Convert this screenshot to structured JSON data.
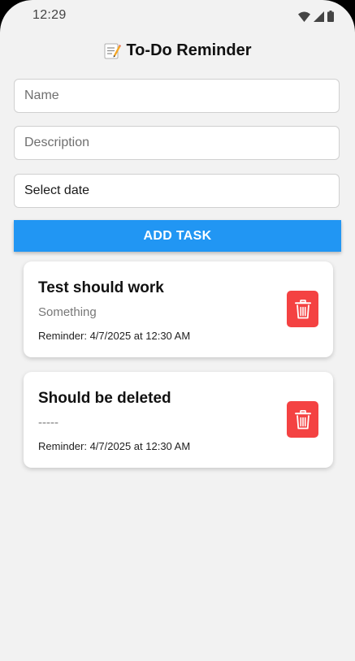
{
  "status_bar": {
    "time": "12:29",
    "icons": [
      "wifi-icon",
      "signal-icon",
      "battery-icon"
    ]
  },
  "header": {
    "icon": "memo-icon",
    "title": "To-Do Reminder"
  },
  "form": {
    "name_placeholder": "Name",
    "name_value": "",
    "description_placeholder": "Description",
    "description_value": "",
    "date_label": "Select date",
    "add_button_label": "ADD TASK"
  },
  "tasks": [
    {
      "title": "Test should work",
      "description": "Something",
      "reminder": "Reminder: 4/7/2025 at 12:30 AM",
      "delete_icon": "trash-icon"
    },
    {
      "title": "Should be deleted",
      "description": "-----",
      "reminder": "Reminder: 4/7/2025 at 12:30 AM",
      "delete_icon": "trash-icon"
    }
  ],
  "colors": {
    "background": "#f2f2f2",
    "accent": "#2196f3",
    "delete": "#f44242",
    "card": "#ffffff"
  }
}
